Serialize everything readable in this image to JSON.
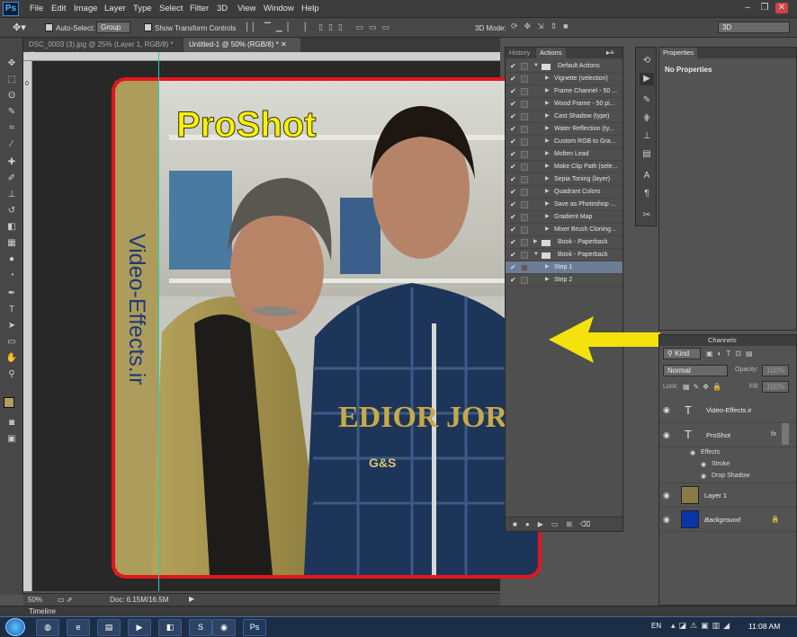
{
  "app": {
    "logo": "Ps",
    "menus": [
      "File",
      "Edit",
      "Image",
      "Layer",
      "Type",
      "Select",
      "Filter",
      "3D",
      "View",
      "Window",
      "Help"
    ]
  },
  "options": {
    "auto_select_label": "Auto-Select:",
    "auto_select_value": "Group",
    "show_transform_label": "Show Transform Controls",
    "mode_label": "3D Mode:",
    "workspace": "3D"
  },
  "tabs": [
    {
      "label": "DSC_0003 (3).jpg @ 25% (Layer 1, RGB/8) *"
    },
    {
      "label": "Untitled-1 @ 50% (RGB/8) *"
    }
  ],
  "ruler_left_label": "0",
  "canvas": {
    "title_text": "ProShot",
    "vertical_text": "Video-Effects.ir",
    "jersey_text_1": "EDIOR JOR",
    "jersey_text_2": "G&S"
  },
  "status": {
    "zoom": "50%",
    "doc": "Doc: 6.15M/16.5M"
  },
  "history_panel": {
    "tab_history": "History",
    "tab_actions": "Actions",
    "actions": [
      "Default Actions",
      "Vignette (selection)",
      "Frame Channel - 50 ...",
      "Wood Frame - 50 pi...",
      "Cast Shadow (type)",
      "Water Reflection (ty...",
      "Custom RGB to Gra...",
      "Molten Lead",
      "Make Clip Path (sele...",
      "Sepia Toning (layer)",
      "Quadrant Colors",
      "Save as Photoshop ...",
      "Gradient Map",
      "Mixer Brush Cloning...",
      "Book - Paperback",
      "Book - Paperback",
      "Step 1",
      "Step 2"
    ]
  },
  "properties": {
    "tab": "Properties",
    "text": "No Properties"
  },
  "layers": {
    "tab": "Channels",
    "kind": "Kind",
    "blend": "Normal",
    "opacity_label": "Opacity:",
    "opacity": "100%",
    "lock_label": "Lock:",
    "fill_label": "Fill:",
    "fill": "100%",
    "items": [
      {
        "name": "Video-Effects.ir"
      },
      {
        "name": "ProShot"
      },
      {
        "name": "Effects"
      },
      {
        "name": "Stroke"
      },
      {
        "name": "Drop Shadow"
      },
      {
        "name": "Layer 1"
      },
      {
        "name": "Background"
      }
    ],
    "fx": "fx"
  },
  "timeline": "Timeline",
  "taskbar": {
    "lang": "EN",
    "time": "11:08 AM"
  },
  "colors": {
    "arrow": "#f4e20c",
    "frame": "#e4161d",
    "guide": "#22d2b4",
    "title": "#f5f20c",
    "bg_layer": "#0a34a8"
  }
}
